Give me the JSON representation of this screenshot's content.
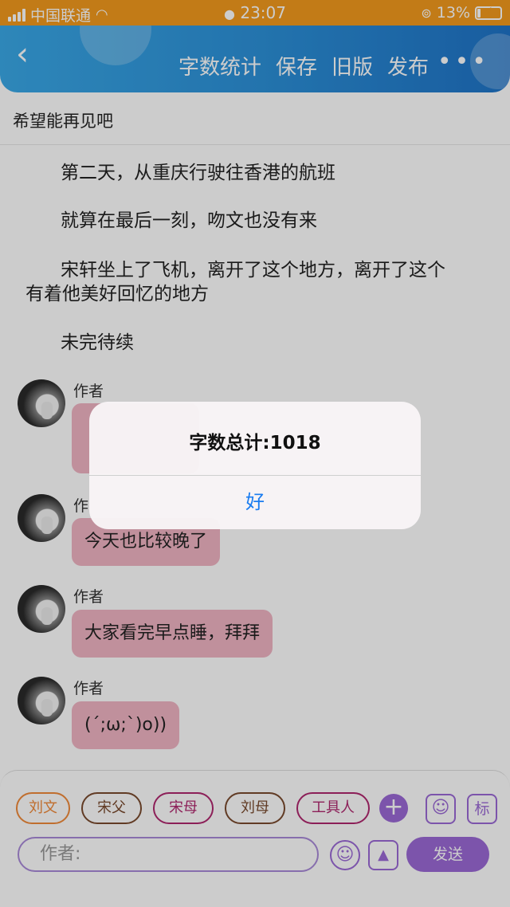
{
  "status_bar": {
    "carrier": "中国联通",
    "time": "23:07",
    "battery": "13%",
    "battery_level": 0.13
  },
  "header": {
    "back_glyph": "‹",
    "word_count_label": "字数统计",
    "save_label": "保存",
    "old_version_label": "旧版",
    "publish_label": "发布",
    "more_glyph": "•••"
  },
  "title": "希望能再见吧",
  "paragraphs": [
    "第二天，从重庆行驶往香港的航班",
    "就算在最后一刻，吻文也没有来",
    "宋轩坐上了飞机，离开了这个地方，离开了这个",
    "有着他美好回忆的地方",
    "未完待续"
  ],
  "messages": [
    {
      "author": "作者",
      "text": ""
    },
    {
      "author": "作",
      "text": "今天也比较晚了"
    },
    {
      "author": "作者",
      "text": "大家看完早点睡，拜拜"
    },
    {
      "author": "作者",
      "text": "(´;ω;`)o))"
    }
  ],
  "roles": [
    {
      "label": "刘文",
      "color": "#f08a3a"
    },
    {
      "label": "宋父",
      "color": "#7a4a2e"
    },
    {
      "label": "宋母",
      "color": "#b0276e"
    },
    {
      "label": "刘母",
      "color": "#7a4a2e"
    },
    {
      "label": "工具人",
      "color": "#b0276e"
    }
  ],
  "role_tag_label": "标",
  "input": {
    "placeholder": "作者:"
  },
  "send_label": "发送",
  "dialog": {
    "message": "字数总计:1018",
    "ok_label": "好"
  },
  "colors": {
    "status_bar": "#f39a1d",
    "header": "#2b8fd8",
    "accent": "#9b6ad6",
    "bubble": "#f0b4c3",
    "dialog_button": "#1a7cf0"
  }
}
